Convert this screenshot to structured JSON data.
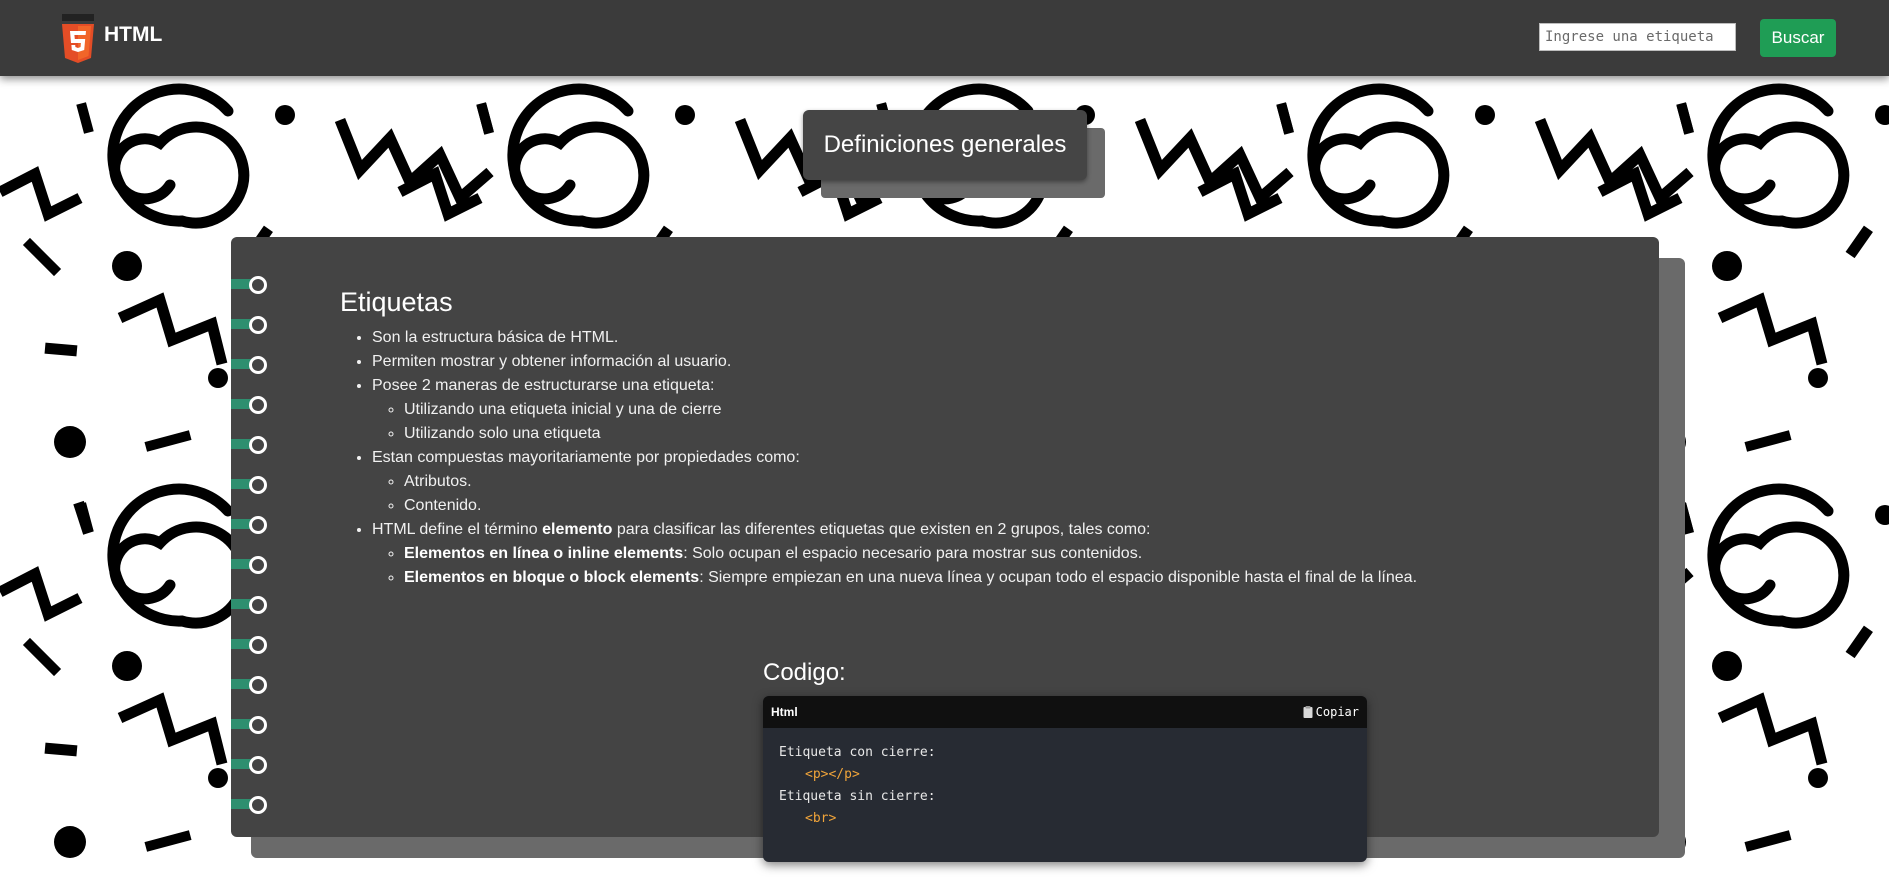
{
  "header": {
    "logo_icon": "html5-logo-icon",
    "brand_name": "HTML",
    "search_placeholder": "Ingrese una etiqueta",
    "search_button": "Buscar"
  },
  "section": {
    "title": "Definiciones generales"
  },
  "content": {
    "heading": "Etiquetas",
    "items": {
      "i0": "Son la estructura básica de HTML.",
      "i1": "Permiten mostrar y obtener información al usuario.",
      "i2": "Posee 2 maneras de estructurarse una etiqueta:",
      "i2a": "Utilizando una etiqueta inicial y una de cierre",
      "i2b": "Utilizando solo una etiqueta",
      "i3": "Estan compuestas mayoritariamente por propiedades como:",
      "i3a": "Atributos.",
      "i3b": "Contenido.",
      "i4_pre": "HTML define el término ",
      "i4_bold": "elemento",
      "i4_post": " para clasificar las diferentes etiquetas que existen en 2 grupos, tales como:",
      "i4a_bold": "Elementos en línea o inline elements",
      "i4a_rest": ": Solo ocupan el espacio necesario para mostrar sus contenidos.",
      "i4b_bold": "Elementos en bloque o block elements",
      "i4b_rest": ": Siempre empiezan en una nueva línea y ocupan todo el espacio disponible hasta el final de la línea."
    }
  },
  "code": {
    "title": "Codigo:",
    "language": "Html",
    "copy_label": "Copiar",
    "copy_icon": "clipboard-icon",
    "lines": {
      "l0": "Etiqueta con cierre:",
      "l1": "<p></p>",
      "l2": "Etiqueta sin cierre:",
      "l3": "<br>"
    }
  },
  "colors": {
    "navbar": "#3b3b3b",
    "panel": "#444444",
    "accent_green": "#1f9d55",
    "ring_teal": "#2e8f6f",
    "code_tag": "#f0a43a"
  }
}
